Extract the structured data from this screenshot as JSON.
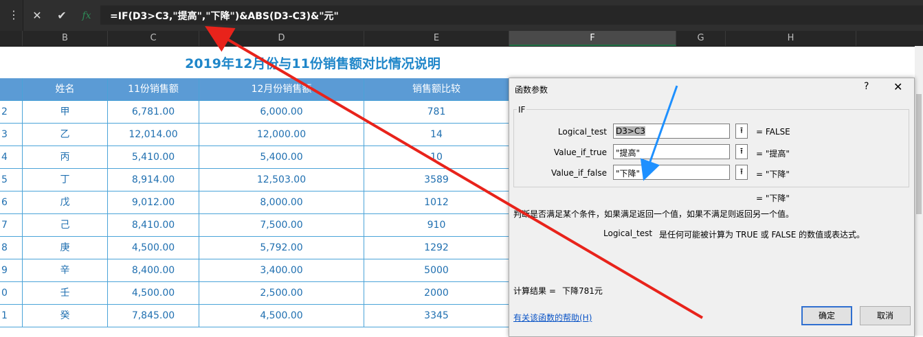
{
  "formula_bar": {
    "menu_icon": "kebab-icon",
    "cancel_icon": "close-icon",
    "enter_icon": "check-icon",
    "fx_label": "fx",
    "formula": "=IF(D3>C3,\"提高\",\"下降\")&ABS(D3-C3)&\"元\""
  },
  "columns": [
    "B",
    "C",
    "D",
    "E",
    "F",
    "G",
    "H"
  ],
  "selected_column": "F",
  "sheet": {
    "title": "2019年12月份与11份销售额对比情况说明",
    "headers": [
      "姓名",
      "11份销售额",
      "12月份销售额",
      "销售额比较"
    ],
    "rows": [
      {
        "rn": "2",
        "name": "甲",
        "nov": "6,781.00",
        "dec": "6,000.00",
        "cmp": "781"
      },
      {
        "rn": "3",
        "name": "乙",
        "nov": "12,014.00",
        "dec": "12,000.00",
        "cmp": "14"
      },
      {
        "rn": "4",
        "name": "丙",
        "nov": "5,410.00",
        "dec": "5,400.00",
        "cmp": "10"
      },
      {
        "rn": "5",
        "name": "丁",
        "nov": "8,914.00",
        "dec": "12,503.00",
        "cmp": "3589"
      },
      {
        "rn": "6",
        "name": "戊",
        "nov": "9,012.00",
        "dec": "8,000.00",
        "cmp": "1012"
      },
      {
        "rn": "7",
        "name": "己",
        "nov": "8,410.00",
        "dec": "7,500.00",
        "cmp": "910"
      },
      {
        "rn": "8",
        "name": "庚",
        "nov": "4,500.00",
        "dec": "5,792.00",
        "cmp": "1292"
      },
      {
        "rn": "9",
        "name": "辛",
        "nov": "8,400.00",
        "dec": "3,400.00",
        "cmp": "5000"
      },
      {
        "rn": "0",
        "name": "壬",
        "nov": "4,500.00",
        "dec": "2,500.00",
        "cmp": "2000"
      },
      {
        "rn": "1",
        "name": "癸",
        "nov": "7,845.00",
        "dec": "4,500.00",
        "cmp": "3345"
      }
    ]
  },
  "dialog": {
    "title": "函数参数",
    "help_button": "?",
    "close_icon": "close-icon",
    "function_name": "IF",
    "args": [
      {
        "label": "Logical_test",
        "value": "D3>C3",
        "result": "=  FALSE"
      },
      {
        "label": "Value_if_true",
        "value": "\"提高\"",
        "result": "=  \"提高\""
      },
      {
        "label": "Value_if_false",
        "value": "\"下降\"",
        "result": "=  \"下降\""
      }
    ],
    "overall_result": "=  \"下降\"",
    "description": "判断是否满足某个条件，如果满足返回一个值，如果不满足则返回另一个值。",
    "param_name": "Logical_test",
    "param_desc": "是任何可能被计算为 TRUE 或 FALSE 的数值或表达式。",
    "calc_label": "计算结果 =",
    "calc_value": "下降781元",
    "help_link": "有关该函数的帮助(H)",
    "ok_label": "确定",
    "cancel_label": "取消"
  },
  "colors": {
    "header_fill": "#5b9bd5",
    "title_text": "#1f86c9",
    "cell_text": "#1f6fb0",
    "red_arrow": "#e8231b",
    "blue_arrow": "#1e90ff"
  }
}
